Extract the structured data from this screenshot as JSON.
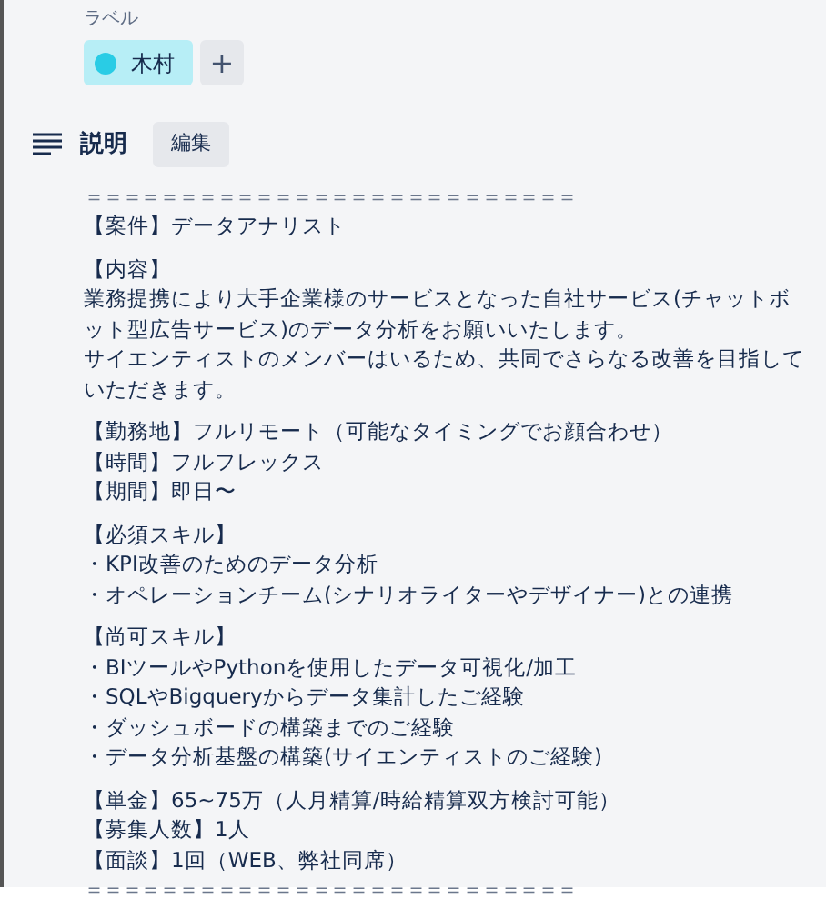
{
  "labels_section": {
    "heading": "ラベル",
    "labels": [
      {
        "text": "木村",
        "color": "#29cce5"
      }
    ],
    "add_button": "+"
  },
  "description": {
    "title": "説明",
    "edit_button": "編集",
    "paragraphs": [
      [
        "＝＝＝＝＝＝＝＝＝＝＝＝＝＝＝＝＝＝＝＝＝＝＝＝＝＝",
        "【案件】データアナリスト"
      ],
      [
        "【内容】",
        "業務提携により大手企業様のサービスとなった自社サービス(チャットボット型広告サービス)のデータ分析をお願いいたします。",
        "サイエンティストのメンバーはいるため、共同でさらなる改善を目指していただきます。"
      ],
      [
        "【勤務地】フルリモート（可能なタイミングでお顔合わせ）",
        "【時間】フルフレックス",
        "【期間】即日〜"
      ],
      [
        "【必須スキル】",
        "・KPI改善のためのデータ分析",
        "・オペレーションチーム(シナリオライターやデザイナー)との連携"
      ],
      [
        "【尚可スキル】",
        "・BIツールやPythonを使用したデータ可視化/加工",
        "・SQLやBigqueryからデータ集計したご経験",
        "・ダッシュボードの構築までのご経験",
        "・データ分析基盤の構築(サイエンティストのご経験)"
      ],
      [
        "【単金】65~75万（人月精算/時給精算双方検討可能）",
        "【募集人数】1人",
        "【面談】1回（WEB、弊社同席）",
        "＝＝＝＝＝＝＝＝＝＝＝＝＝＝＝＝＝＝＝＝＝＝＝＝＝＝"
      ]
    ]
  }
}
